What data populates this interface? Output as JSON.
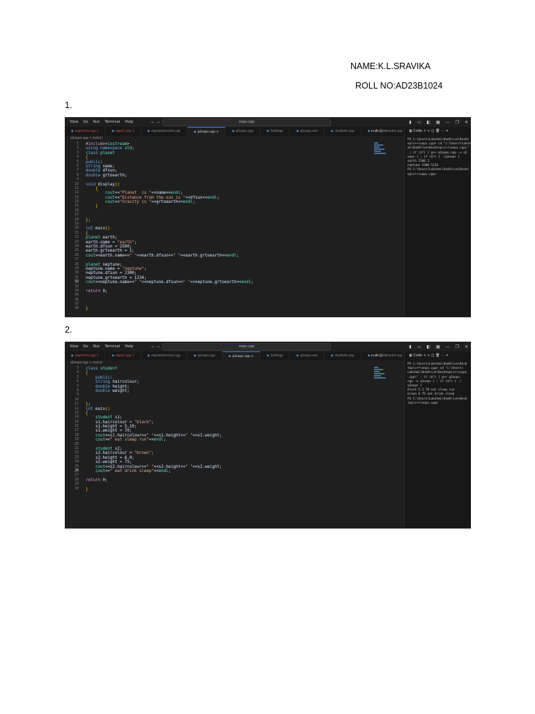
{
  "document": {
    "name_line": "NAME:K.L.SRAVIKA",
    "roll_line": "ROLL NO:AD23B1024",
    "q1_label": "1.",
    "q2_label": "2."
  },
  "screenshots": [
    {
      "menu": [
        "View",
        "Go",
        "Run",
        "Terminal",
        "Help"
      ],
      "search": "oops.cpp",
      "tabs": [
        {
          "label": "oopsintro.cpp 1",
          "state": "error"
        },
        {
          "label": "oops1.cpp 1",
          "state": "error"
        },
        {
          "label": "oopsdestructor.cpp",
          "state": "normal"
        },
        {
          "label": "q1oops.cpp ×",
          "state": "active"
        },
        {
          "label": "q2oops.cpp",
          "state": "normal"
        },
        {
          "label": "Settings",
          "state": "normal"
        },
        {
          "label": "q1oops.exe",
          "state": "normal"
        },
        {
          "label": "students.cpp",
          "state": "normal"
        },
        {
          "label": "oopsconstructor.cpp",
          "state": "normal"
        }
      ],
      "breadcrumb": "q1oops.cpp > main()",
      "first_line": 1,
      "current_line": 32,
      "code": [
        "#include<iostream>",
        "using namespace std;",
        "class planet",
        "{",
        "public:",
        "string name;",
        "double dfsun;",
        "double grtoearth;",
        "",
        "void display()",
        "    {",
        "        cout<<\"Planet  is \"<<name<<endl;",
        "        cout<<\"Distance from the sun is \"<<dfsun<<endl;",
        "        cout<<\"Gravity is \"<<grtoearth<<endl;",
        "    }",
        "",
        "",
        "};",
        "",
        "int main()",
        "{",
        "planet earth;",
        "earth.name = \"earth\";",
        "earth.dfsun = 2500;",
        "earth.grtoearth = 1;",
        "cout<<earth.name<<\" \"<<earth.dfsun<<\" \"<<earth.grtoearth<<endl;",
        "",
        "planet neptune;",
        "neptune.name = \"neptune\";",
        "neptune.dfsun = 2300;",
        "neptune.grtoearth = 1234;",
        "cout<<neptune.name<<\" \"<<neptune.dfsun<<\" \"<<neptune.grtoearth<<endl;",
        "",
        "return 0;",
        "",
        "",
        "",
        "}"
      ],
      "terminal_title": "Code",
      "terminal": [
        "PS C:\\Users\\Lakshmi\\OneDrive\\Deskt",
        "op\\c++\\oops.cpp> cd \"c:\\Users\\Laksh",
        "mi\\OneDrive\\Desktop\\c++\\oops.cpp\\\"",
        " ; if ($?) { g++ q1oops.cpp -o q1",
        "oops } ; if ($?) { .\\q1oops }",
        "earth 2500 1",
        "neptune 2300 1234",
        "PS C:\\Users\\Lakshmi\\OneDrive\\Deskt",
        "op\\c++\\oops.cpp>"
      ]
    },
    {
      "menu": [
        "View",
        "Go",
        "Run",
        "Terminal",
        "Help"
      ],
      "search": "oops.cpp",
      "tabs": [
        {
          "label": "oopsintro.cpp 1",
          "state": "error"
        },
        {
          "label": "oops1.cpp 1",
          "state": "error"
        },
        {
          "label": "oopsdestructor.cpp",
          "state": "normal"
        },
        {
          "label": "q1oops.cpp",
          "state": "normal"
        },
        {
          "label": "q2oops.cpp ×",
          "state": "active"
        },
        {
          "label": "Settings",
          "state": "normal"
        },
        {
          "label": "q1oops.exe",
          "state": "normal"
        },
        {
          "label": "students.cpp",
          "state": "normal"
        },
        {
          "label": "oopsconstructor.cpp",
          "state": "normal"
        }
      ],
      "breadcrumb": "q2oops.cpp > main()",
      "first_line": 3,
      "current_line": 26,
      "code": [
        "class student",
        "{",
        "    public:",
        "    string haircolour;",
        "    double height;",
        "    double weight;",
        "",
        "",
        "};",
        "int main()",
        "{",
        "    student s1;",
        "    s1.haircolour = \"black\";",
        "    s1.height = 5.10;",
        "    s1.weight = 70;",
        "    cout<<s1.haircolour<<\" \"<<s1.height<<\" \"<<s1.weight;",
        "    cout<<\" eat sleep run\"<<endl;",
        "",
        "    student s2;",
        "    s2.haircolour = \"brown\";",
        "    s2.height = 6.0;",
        "    s2.weight = 75;",
        "    cout<<s2.haircolour<<\" \"<<s2.height<<\" \"<<s2.weight;",
        "    cout<<\" eat drink sleep\"<<endl;",
        "",
        "return 0;",
        "",
        "}"
      ],
      "terminal_title": "Code",
      "terminal": [
        "PS C:\\Users\\Lakshmi\\OneDrive\\Desk",
        "top\\c++\\oops.cpp> cd \"c:\\Users\\",
        "Lakshmi\\OneDrive\\Desktop\\c++\\oops",
        ".cpp\\\" ; if ($?) { g++ q2oops.",
        "cpp -o q2oops } ; if ($?) { .\\",
        "q2oops }",
        "black 5.1 70 eat sleep run",
        "brown 6 75 eat drink sleep",
        "PS C:\\Users\\Lakshmi\\OneDrive\\Desk",
        "top\\c++\\oops.cpp>"
      ]
    }
  ]
}
